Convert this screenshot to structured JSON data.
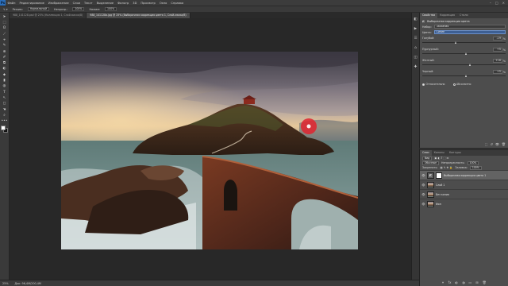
{
  "app": {
    "logo": "Ps",
    "menu": [
      "Файл",
      "Редактирование",
      "Изображение",
      "Слои",
      "Текст",
      "Выделение",
      "Фильтр",
      "3D",
      "Просмотр",
      "Окно",
      "Справка"
    ],
    "window_buttons": [
      "–",
      "□",
      "×"
    ]
  },
  "options": {
    "mode_label": "Режим:",
    "mode_value": "Нормальный",
    "opacity_label": "Непрозр.:",
    "opacity_value": "100%",
    "flow_label": "Нажим:",
    "flow_value": "100%"
  },
  "tabs": [
    {
      "label": "988_141128.psd @ 25% (Коллекция 1, Слой-маска/8)"
    },
    {
      "label": "988_141128a.jpg @ 25% (Выборочная коррекция цвета 1, Слой-маска/8)"
    }
  ],
  "tools": [
    "➤",
    "⬚",
    "ʘ",
    "⟋",
    "⌖",
    "✎",
    "⊕",
    "✐",
    "⧉",
    "◐",
    "⬥",
    "▮",
    "◍",
    "T",
    "↖",
    "◻",
    "☚",
    "⌕",
    "•••"
  ],
  "status": {
    "zoom": "25%",
    "doc": "Док: 96,4M/200,4M"
  },
  "right_strip_icons": [
    "◧",
    "▶",
    "☰",
    "⌂",
    "◫",
    "✚"
  ],
  "properties": {
    "tabs": [
      "Свойства",
      "Коррекция",
      "Стили"
    ],
    "title": "Выборочная коррекция цвета",
    "preset_label": "Набор:",
    "preset_value": "Заказная",
    "colors_label": "Цвета:",
    "colors_value": "Синие",
    "sliders": [
      {
        "label": "Голубой:",
        "value": "-19",
        "unit": "%",
        "level": 0.4
      },
      {
        "label": "Пурпурный:",
        "value": "+5",
        "unit": "%",
        "level": 0.53
      },
      {
        "label": "Желтый:",
        "value": "+16",
        "unit": "%",
        "level": 0.58
      },
      {
        "label": "Черный:",
        "value": "+5",
        "unit": "%",
        "level": 0.53
      }
    ],
    "method_relative": "Относительно",
    "method_absolute": "Абсолютно",
    "method_selected": "relative",
    "footer_icons": [
      "⬚",
      "↺",
      "👁",
      "🗑"
    ]
  },
  "layers": {
    "tabs": [
      "Слои",
      "Каналы",
      "Контуры"
    ],
    "kind_label": "Вид",
    "blend_value": "Обычные",
    "opacity_label": "Непрозрачность:",
    "opacity_value": "100%",
    "lock_label": "Закрепить:",
    "fill_label": "Заливка:",
    "fill_value": "100%",
    "items": [
      {
        "name": "Выборочная коррекция цвета 1",
        "selected": true,
        "type": "adjustment"
      },
      {
        "name": "Слой 1",
        "selected": false,
        "type": "image"
      },
      {
        "name": "Без копия",
        "selected": false,
        "type": "image"
      },
      {
        "name": "Фон",
        "selected": false,
        "type": "image"
      }
    ],
    "footer_icons": [
      "⚭",
      "fx",
      "◐",
      "◑",
      "▭",
      "⊞",
      "🗑"
    ]
  }
}
